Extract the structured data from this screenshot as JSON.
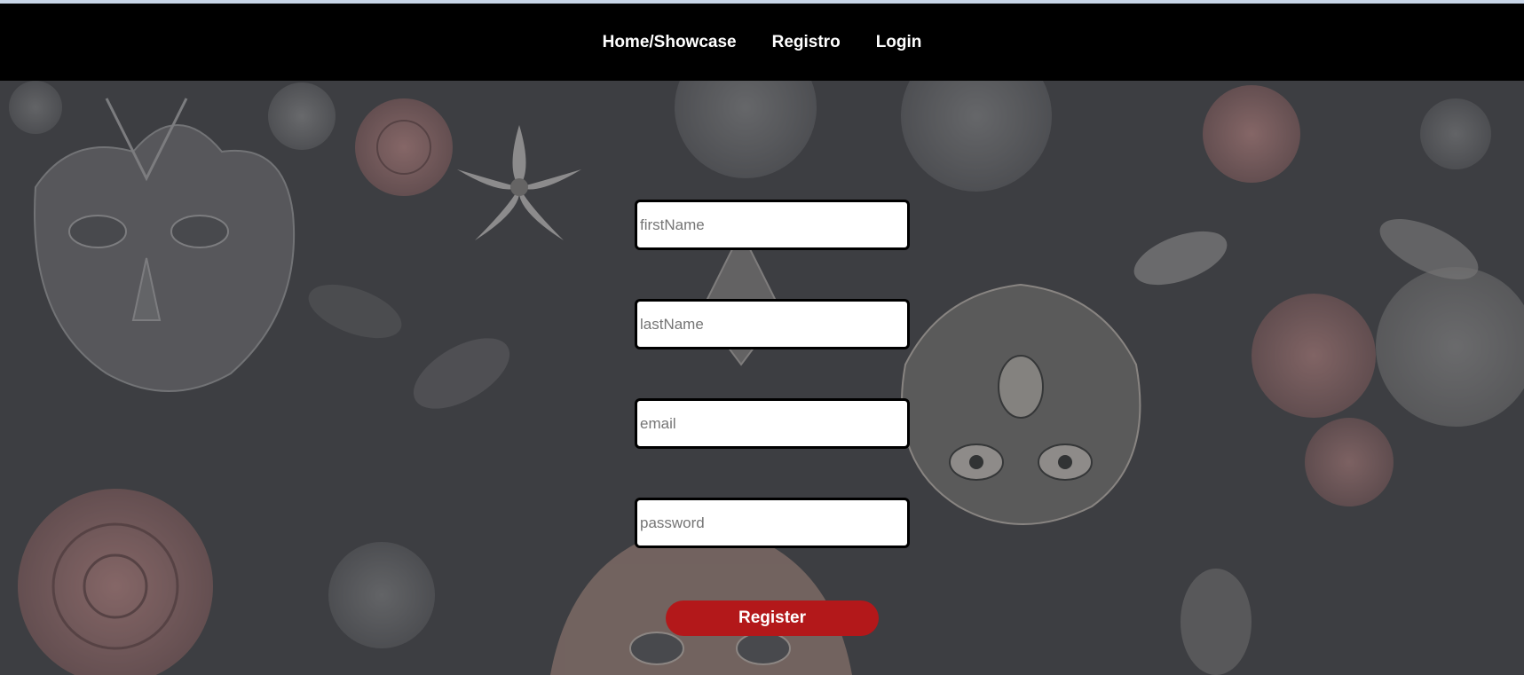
{
  "nav": {
    "links": [
      {
        "label": "Home/Showcase"
      },
      {
        "label": "Registro"
      },
      {
        "label": "Login"
      }
    ]
  },
  "form": {
    "first_name": {
      "placeholder": "firstName",
      "value": ""
    },
    "last_name": {
      "placeholder": "lastName",
      "value": ""
    },
    "email": {
      "placeholder": "email",
      "value": ""
    },
    "password": {
      "placeholder": "password",
      "value": ""
    },
    "submit_label": "Register"
  },
  "colors": {
    "navbar": "#000000",
    "background": "#48494d",
    "register_button": "#b3181a",
    "input_background": "#ffffff",
    "input_border": "#000000"
  },
  "background_image": {
    "icon": "floral-owl-pattern"
  }
}
